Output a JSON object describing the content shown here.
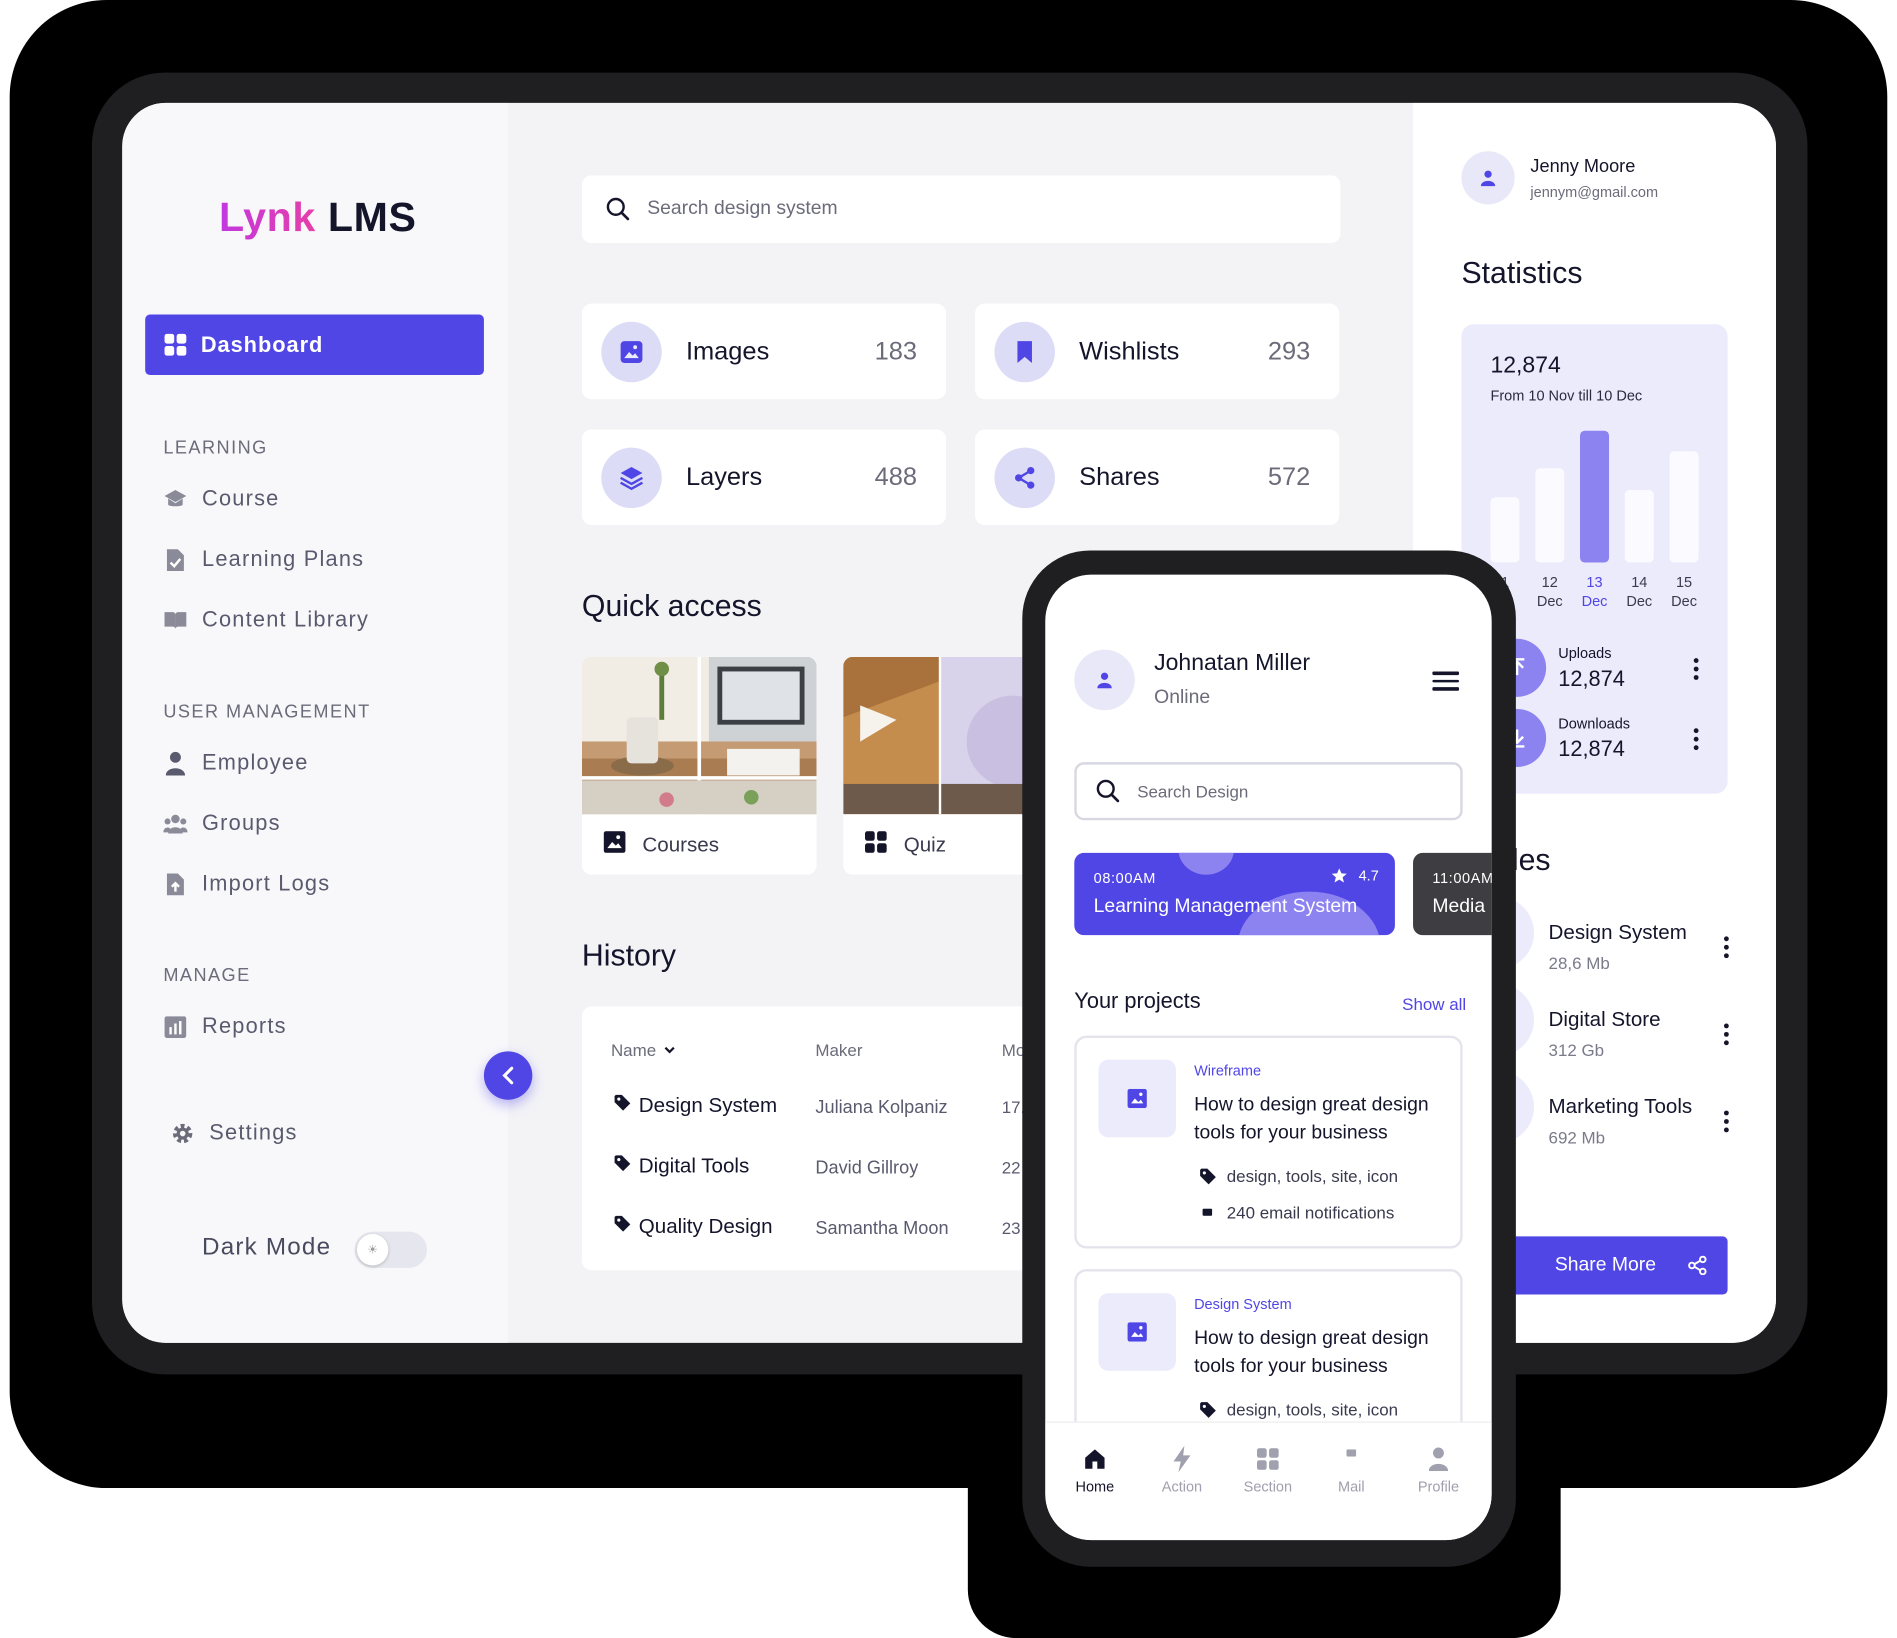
{
  "app": {
    "logo_brand": "Lynk",
    "logo_suffix": "LMS"
  },
  "sidebar": {
    "active": {
      "label": "Dashboard",
      "icon": "grid-icon"
    },
    "sections": [
      {
        "title": "LEARNING",
        "items": [
          {
            "label": "Course",
            "icon": "graduation-cap-icon"
          },
          {
            "label": "Learning Plans",
            "icon": "file-check-icon"
          },
          {
            "label": "Content Library",
            "icon": "book-open-icon"
          }
        ]
      },
      {
        "title": "USER MANAGEMENT",
        "items": [
          {
            "label": "Employee",
            "icon": "user-icon"
          },
          {
            "label": "Groups",
            "icon": "users-icon"
          },
          {
            "label": "Import Logs",
            "icon": "file-upload-icon"
          }
        ]
      },
      {
        "title": "MANAGE",
        "items": [
          {
            "label": "Reports",
            "icon": "bar-chart-icon"
          }
        ]
      }
    ],
    "settings": "Settings",
    "dark_mode": "Dark Mode"
  },
  "search": {
    "placeholder": "Search design system"
  },
  "stats_cards": [
    {
      "label": "Images",
      "value": "183",
      "icon": "image-icon"
    },
    {
      "label": "Wishlists",
      "value": "293",
      "icon": "bookmark-icon"
    },
    {
      "label": "Layers",
      "value": "488",
      "icon": "layers-icon"
    },
    {
      "label": "Shares",
      "value": "572",
      "icon": "share-icon"
    }
  ],
  "quick_access": {
    "title": "Quick access",
    "items": [
      {
        "label": "Courses",
        "icon": "image-icon"
      },
      {
        "label": "Quiz",
        "icon": "grid-icon"
      }
    ]
  },
  "history": {
    "title": "History",
    "columns": [
      "Name",
      "Maker",
      "Mo"
    ],
    "rows": [
      {
        "name": "Design System",
        "maker": "Juliana Kolpaniz",
        "mod": "17.1"
      },
      {
        "name": "Digital Tools",
        "maker": "David Gillroy",
        "mod": "22"
      },
      {
        "name": "Quality Design",
        "maker": "Samantha Moon",
        "mod": "23"
      }
    ]
  },
  "right_panel": {
    "user": {
      "name": "Jenny Moore",
      "email": "jennym@gmail.com"
    },
    "statistics_title": "Statistics",
    "stats": {
      "total": "12,874",
      "range": "From 10 Nov till 10 Dec",
      "uploads_label": "Uploads",
      "uploads_value": "12,874",
      "downloads_label": "Downloads",
      "downloads_value": "12,874"
    },
    "files_title": "re files",
    "files": [
      {
        "name": "Design System",
        "size": "28,6 Mb"
      },
      {
        "name": "Digital Store",
        "size": "312 Gb"
      },
      {
        "name": "Marketing Tools",
        "size": "692 Mb"
      }
    ],
    "share_button": "Share More"
  },
  "chart_data": {
    "type": "bar",
    "categories": [
      "11 Dec",
      "12 Dec",
      "13 Dec",
      "14 Dec",
      "15 Dec"
    ],
    "tick_labels": [
      {
        "top": "1",
        "bottom": "c"
      },
      {
        "top": "12",
        "bottom": "Dec"
      },
      {
        "top": "13",
        "bottom": "Dec"
      },
      {
        "top": "14",
        "bottom": "Dec"
      },
      {
        "top": "15",
        "bottom": "Dec"
      }
    ],
    "values": [
      55,
      80,
      112,
      62,
      94
    ],
    "highlighted_index": 2,
    "title": "",
    "xlabel": "",
    "ylabel": "",
    "ylim": [
      0,
      115
    ],
    "grid": false
  },
  "phone": {
    "user": {
      "name": "Johnatan Miller",
      "status": "Online"
    },
    "search_placeholder": "Search Design",
    "events": [
      {
        "time": "08:00AM",
        "title": "Learning Management System",
        "rating": "4.7"
      },
      {
        "time": "11:00AM",
        "title": "Media"
      }
    ],
    "projects_title": "Your projects",
    "show_all": "Show all",
    "projects": [
      {
        "tag": "Wireframe",
        "title": "How to design great design tools for your business",
        "tags": "design, tools, site, icon",
        "notifications": "240 email notifications"
      },
      {
        "tag": "Design System",
        "title": "How to design great design tools for your business",
        "tags": "design, tools, site, icon"
      }
    ],
    "tabs": [
      {
        "label": "Home",
        "icon": "home-icon"
      },
      {
        "label": "Action",
        "icon": "lightning-icon"
      },
      {
        "label": "Section",
        "icon": "grid-icon"
      },
      {
        "label": "Mail",
        "icon": "mail-icon"
      },
      {
        "label": "Profile",
        "icon": "user-icon"
      }
    ]
  },
  "colors": {
    "accent": "#5046e5",
    "accent_light": "#ebebfc",
    "bar_active": "#8c82f0",
    "brand_pink": "#d63ad1"
  }
}
